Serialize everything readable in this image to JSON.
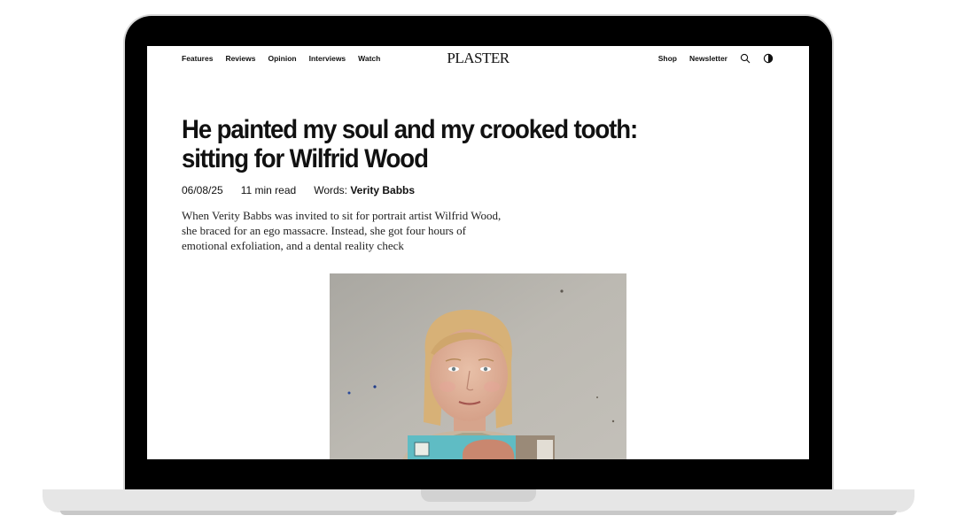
{
  "nav": {
    "left_items": [
      "Features",
      "Reviews",
      "Opinion",
      "Interviews",
      "Watch"
    ],
    "logo": "PLASTER",
    "right_items": [
      "Shop",
      "Newsletter"
    ],
    "icons": [
      "search-icon",
      "contrast-toggle-icon"
    ]
  },
  "article": {
    "headline_line1": "He painted my soul and my crooked tooth:",
    "headline_line2": "sitting for Wilfrid Wood",
    "date": "06/08/25",
    "read_time": "11 min read",
    "words_label": "Words:",
    "author": "Verity Babbs",
    "standfirst": "When Verity Babbs was invited to sit for portrait artist Wilfrid Wood, she braced for an ego massacre. Instead, she got four hours of emotional exfoliation, and a dental reality check"
  },
  "colors": {
    "text": "#111111",
    "frame": "#000000",
    "base": "#e6e6e6"
  }
}
